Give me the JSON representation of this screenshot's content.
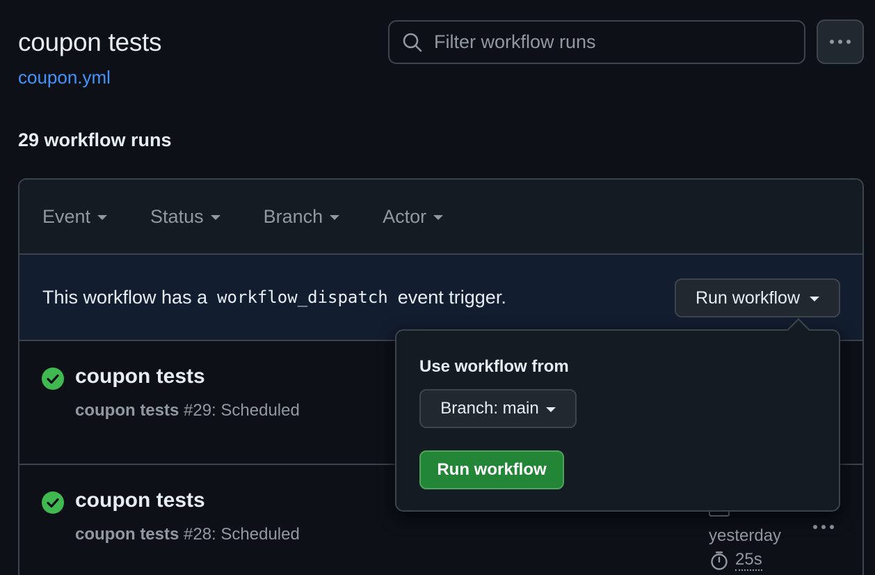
{
  "header": {
    "title": "coupon tests",
    "file_link": "coupon.yml",
    "search_placeholder": "Filter workflow runs"
  },
  "runs_count": "29 workflow runs",
  "filters": [
    "Event",
    "Status",
    "Branch",
    "Actor"
  ],
  "dispatch": {
    "text_before": "This workflow has a",
    "code": "workflow_dispatch",
    "text_after": "event trigger.",
    "run_dropdown_label": "Run workflow"
  },
  "runs": [
    {
      "name": "coupon tests",
      "sub_bold": "coupon tests",
      "sub_rest": " #29: Scheduled"
    },
    {
      "name": "coupon tests",
      "sub_bold": "coupon tests",
      "sub_rest": " #28: Scheduled",
      "time": "yesterday",
      "duration": "25s"
    }
  ],
  "popover": {
    "label": "Use workflow from",
    "branch_label": "Branch: main",
    "run_button": "Run workflow"
  },
  "colors": {
    "accent_link": "#4493f8",
    "success": "#3fb950",
    "primary_button": "#238636"
  }
}
